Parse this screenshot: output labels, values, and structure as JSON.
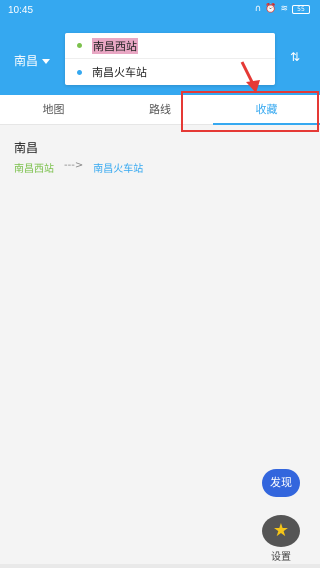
{
  "status_bar": {
    "time": "10:45",
    "battery": "55"
  },
  "header": {
    "city": "南昌",
    "route": {
      "from": "南昌西站",
      "to": "南昌火车站"
    }
  },
  "tabs": [
    "地图",
    "路线",
    "收藏"
  ],
  "active_tab": "收藏",
  "favorites": {
    "city": "南昌",
    "from": "南昌西站",
    "arrow": "--->",
    "to": "南昌火车站"
  },
  "floating": {
    "discover": "发现",
    "settings": "设置"
  },
  "colors": {
    "primary": "#35a8f0",
    "green": "#7cc14d",
    "annotation": "#e53935"
  }
}
